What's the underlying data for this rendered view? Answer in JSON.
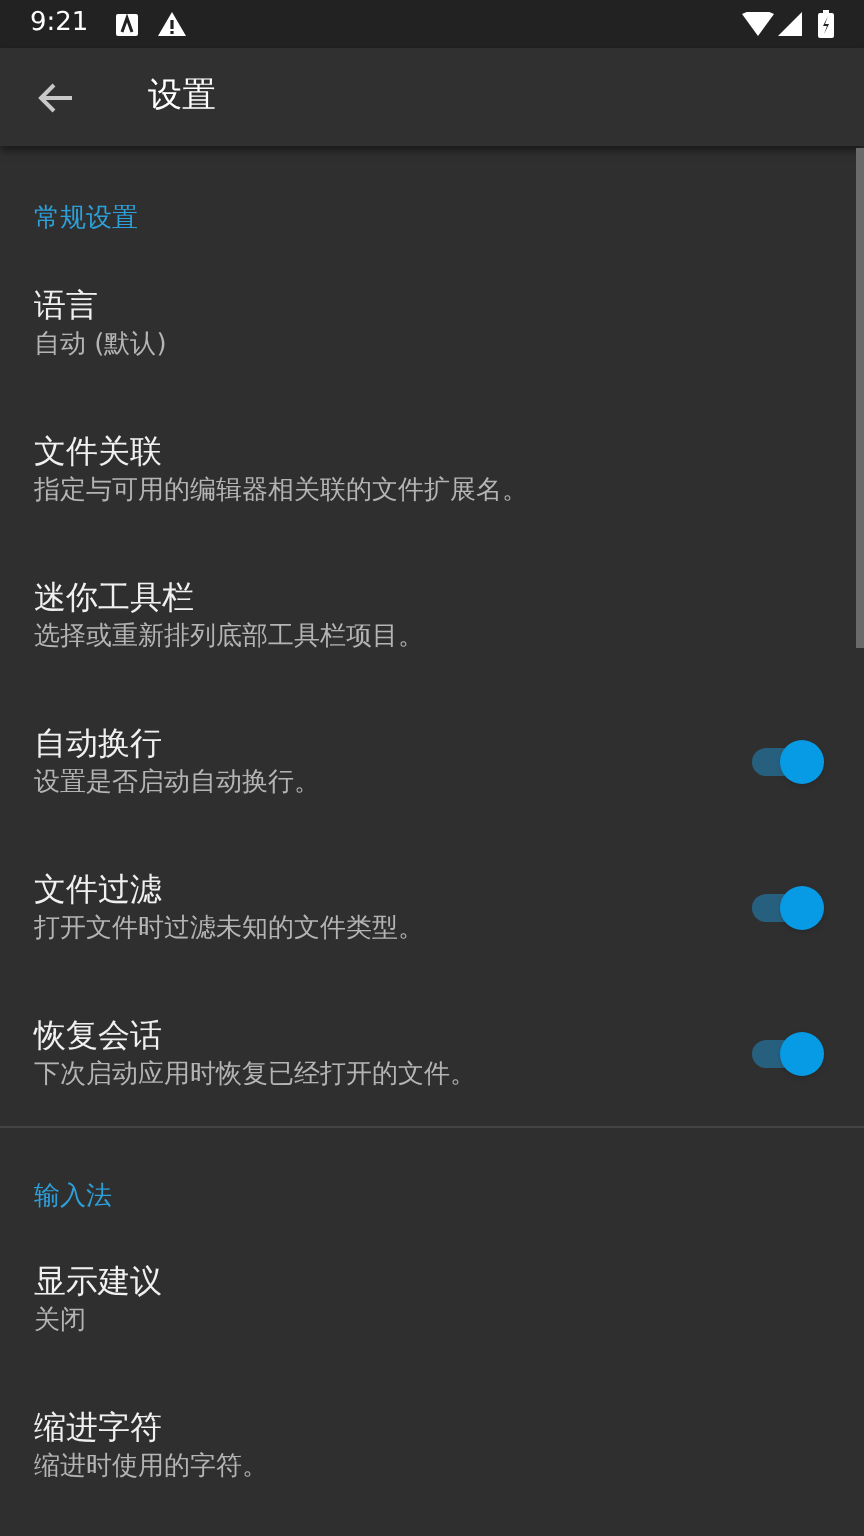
{
  "status_bar": {
    "time": "9:21"
  },
  "app_bar": {
    "title": "设置"
  },
  "sections": [
    {
      "header": "常规设置",
      "items": [
        {
          "kind": "text",
          "title": "语言",
          "summary": "自动 (默认)"
        },
        {
          "kind": "text",
          "title": "文件关联",
          "summary": "指定与可用的编辑器相关联的文件扩展名。"
        },
        {
          "kind": "text",
          "title": "迷你工具栏",
          "summary": "选择或重新排列底部工具栏项目。"
        },
        {
          "kind": "switch",
          "title": "自动换行",
          "summary": "设置是否启动自动换行。",
          "on": true
        },
        {
          "kind": "switch",
          "title": "文件过滤",
          "summary": "打开文件时过滤未知的文件类型。",
          "on": true
        },
        {
          "kind": "switch",
          "title": "恢复会话",
          "summary": "下次启动应用时恢复已经打开的文件。",
          "on": true
        }
      ]
    },
    {
      "header": "输入法",
      "items": [
        {
          "kind": "text",
          "title": "显示建议",
          "summary": "关闭"
        },
        {
          "kind": "text",
          "title": "缩进字符",
          "summary": "缩进时使用的字符。"
        }
      ]
    }
  ]
}
